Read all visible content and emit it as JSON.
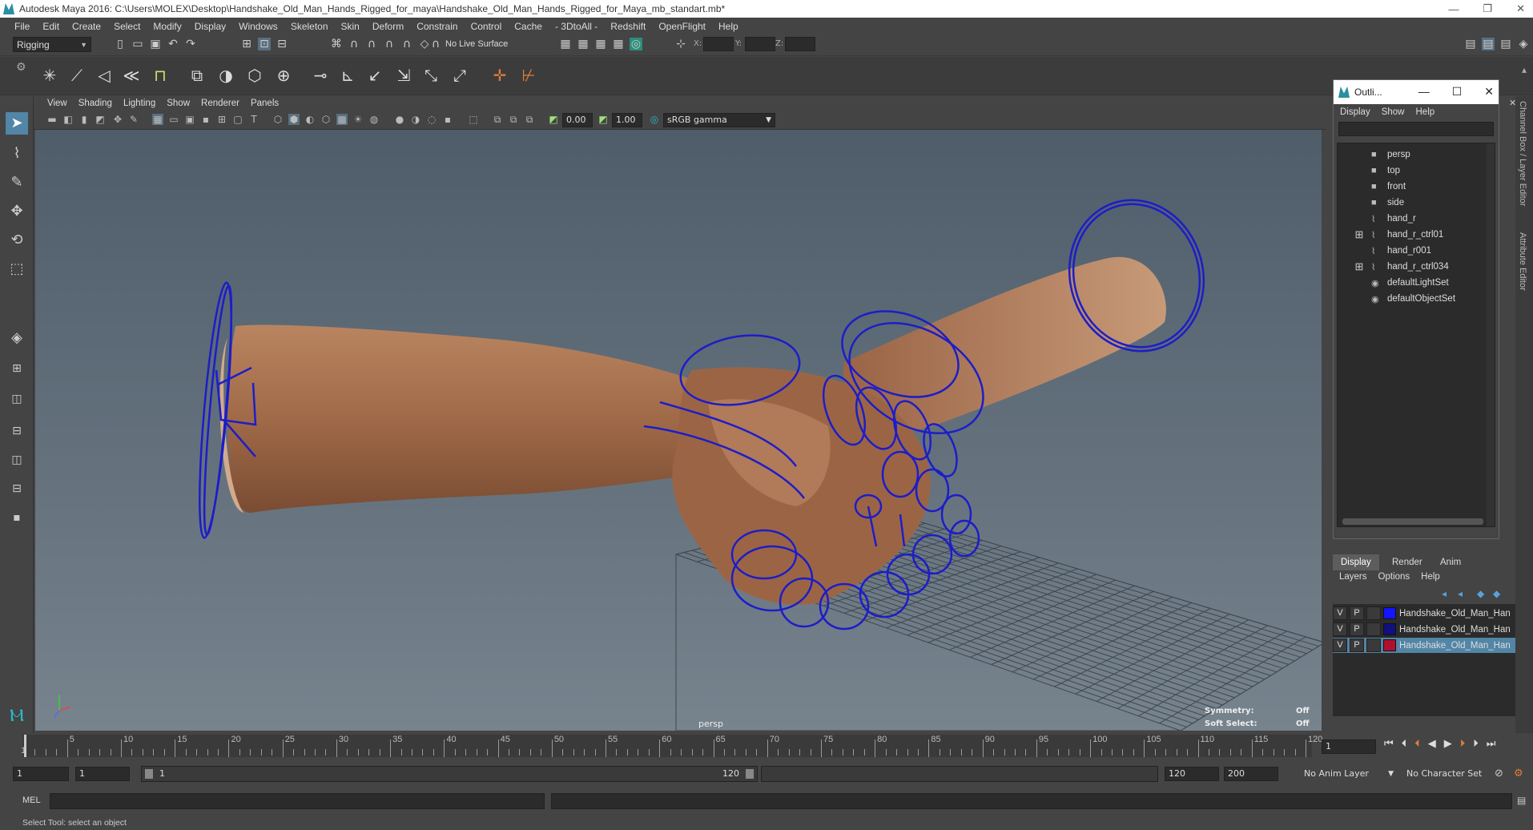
{
  "window": {
    "title": "Autodesk Maya 2016: C:\\Users\\MOLEX\\Desktop\\Handshake_Old_Man_Hands_Rigged_for_maya\\Handshake_Old_Man_Hands_Rigged_for_Maya_mb_standart.mb*"
  },
  "menubar": [
    "File",
    "Edit",
    "Create",
    "Select",
    "Modify",
    "Display",
    "Windows",
    "Skeleton",
    "Skin",
    "Deform",
    "Constrain",
    "Control",
    "Cache",
    "- 3DtoAll -",
    "Redshift",
    "OpenFlight",
    "Help"
  ],
  "statusline": {
    "mode": "Rigging",
    "live_surface": "No Live Surface",
    "x_label": "X:",
    "y_label": "Y:",
    "z_label": "Z:"
  },
  "panel_menu": [
    "View",
    "Shading",
    "Lighting",
    "Show",
    "Renderer",
    "Panels"
  ],
  "panel_toolbar": {
    "exposure": "0.00",
    "gamma": "1.00",
    "color_space": "sRGB gamma"
  },
  "viewport": {
    "camera_label": "persp",
    "symmetry_label": "Symmetry:",
    "symmetry_value": "Off",
    "soft_select_label": "Soft Select:",
    "soft_select_value": "Off"
  },
  "outliner": {
    "title": "Outli...",
    "menu": [
      "Display",
      "Show",
      "Help"
    ],
    "items": [
      {
        "label": "persp",
        "icon": "camera-icon",
        "expandable": false
      },
      {
        "label": "top",
        "icon": "camera-icon",
        "expandable": false
      },
      {
        "label": "front",
        "icon": "camera-icon",
        "expandable": false
      },
      {
        "label": "side",
        "icon": "camera-icon",
        "expandable": false
      },
      {
        "label": "hand_r",
        "icon": "curve-icon",
        "expandable": false
      },
      {
        "label": "hand_r_ctrl01",
        "icon": "curve-icon",
        "expandable": true
      },
      {
        "label": "hand_r001",
        "icon": "curve-icon",
        "expandable": false
      },
      {
        "label": "hand_r_ctrl034",
        "icon": "curve-icon",
        "expandable": true
      },
      {
        "label": "defaultLightSet",
        "icon": "set-icon",
        "expandable": false
      },
      {
        "label": "defaultObjectSet",
        "icon": "set-icon",
        "expandable": false
      }
    ]
  },
  "right_tabs": [
    "Channel Box / Layer Editor",
    "Attribute Editor"
  ],
  "layer_editor": {
    "tabs": [
      "Display",
      "Render",
      "Anim"
    ],
    "menu": [
      "Layers",
      "Options",
      "Help"
    ],
    "layers": [
      {
        "v": "V",
        "p": "P",
        "color": "#1414ff",
        "name": "Handshake_Old_Man_Han",
        "selected": false
      },
      {
        "v": "V",
        "p": "P",
        "color": "#101080",
        "name": "Handshake_Old_Man_Han",
        "selected": false
      },
      {
        "v": "V",
        "p": "P",
        "color": "#b01030",
        "name": "Handshake_Old_Man_Han",
        "selected": true
      }
    ]
  },
  "timeline": {
    "ticks": [
      "5",
      "10",
      "15",
      "20",
      "25",
      "30",
      "35",
      "40",
      "45",
      "50",
      "55",
      "60",
      "65",
      "70",
      "75",
      "80",
      "85",
      "90",
      "95",
      "100",
      "105",
      "110",
      "115",
      "120"
    ],
    "start_tick": "1",
    "end_tick": "120",
    "current_frame": "1"
  },
  "range": {
    "start": "1",
    "playback_start": "1",
    "slider_start": "1",
    "slider_end": "120",
    "playback_end": "120",
    "end": "200",
    "anim_layer": "No Anim Layer",
    "char_set": "No Character Set"
  },
  "mel": {
    "label": "MEL"
  },
  "status": {
    "help_line": "Select Tool: select an object"
  }
}
